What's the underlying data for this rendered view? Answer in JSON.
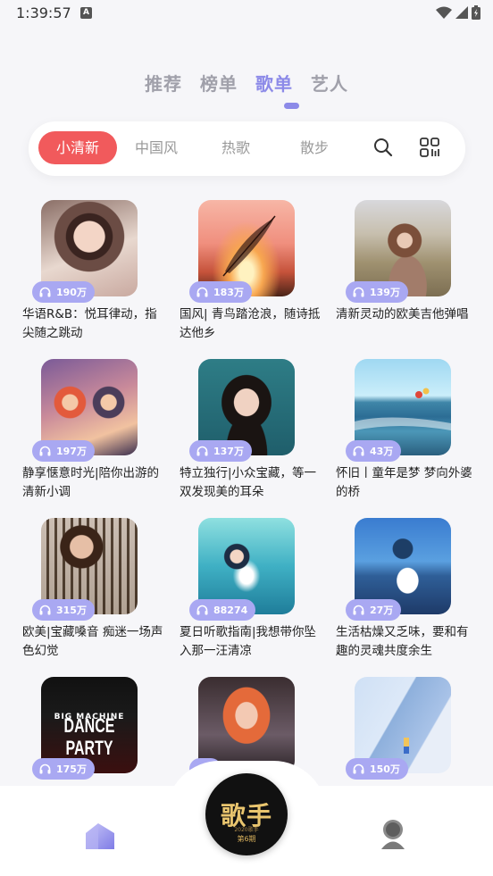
{
  "status": {
    "time": "1:39:57",
    "notif_letter": "A"
  },
  "top_tabs": [
    {
      "label": "推荐",
      "active": false
    },
    {
      "label": "榜单",
      "active": false
    },
    {
      "label": "歌单",
      "active": true
    },
    {
      "label": "艺人",
      "active": false
    }
  ],
  "filters": [
    {
      "label": "小清新",
      "active": true
    },
    {
      "label": "中国风",
      "active": false
    },
    {
      "label": "热歌",
      "active": false
    },
    {
      "label": "散步",
      "active": false
    }
  ],
  "playlists": [
    {
      "plays": "190万",
      "title": "华语R&B：悦耳律动，指尖随之跳动"
    },
    {
      "plays": "183万",
      "title": "国风| 青鸟踏沧浪，随诗抵达他乡"
    },
    {
      "plays": "139万",
      "title": "清新灵动的欧美吉他弹唱"
    },
    {
      "plays": "197万",
      "title": "静享惬意时光|陪你出游的清新小调"
    },
    {
      "plays": "137万",
      "title": "特立独行|小众宝藏，等一双发现美的耳朵"
    },
    {
      "plays": "43万",
      "title": "怀旧丨童年是梦 梦向外婆的桥"
    },
    {
      "plays": "315万",
      "title": "欧美|宝藏嗓音 痴迷一场声色幻觉"
    },
    {
      "plays": "88274",
      "title": "夏日听歌指南|我想带你坠入那一汪清凉"
    },
    {
      "plays": "27万",
      "title": "生活枯燥又乏味，要和有趣的灵魂共度余生"
    },
    {
      "plays": "175万",
      "title": "",
      "cover_text_1": "BIG MACHINE",
      "cover_text_2": "DANCE PARTY"
    },
    {
      "plays": "",
      "title": ""
    },
    {
      "plays": "150万",
      "title": ""
    }
  ],
  "now_playing": {
    "cover_title": "歌手",
    "cover_sub": "第6期",
    "cover_year": "2020歌手"
  },
  "colors": {
    "accent": "#8c8ae8",
    "chip_active": "#f15a5c",
    "badge": "#a9a8f2"
  }
}
